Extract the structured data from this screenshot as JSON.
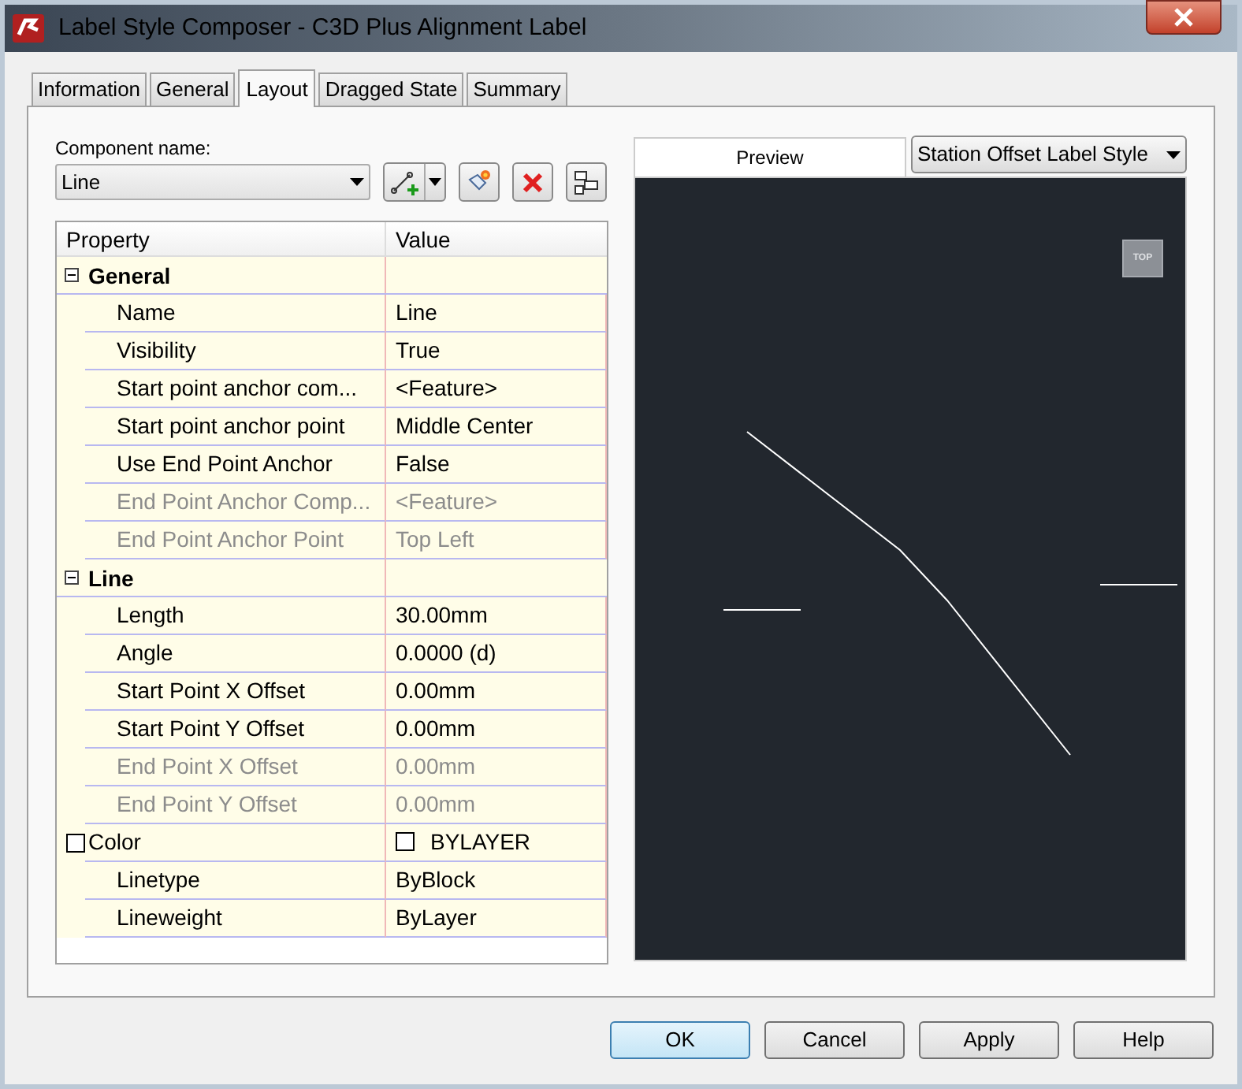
{
  "window": {
    "title": "Label Style Composer - C3D Plus Alignment Label"
  },
  "tabs": [
    {
      "label": "Information",
      "selected": false
    },
    {
      "label": "General",
      "selected": false
    },
    {
      "label": "Layout",
      "selected": true
    },
    {
      "label": "Dragged State",
      "selected": false
    },
    {
      "label": "Summary",
      "selected": false
    }
  ],
  "component": {
    "label": "Component name:",
    "value": "Line"
  },
  "grid": {
    "columns": [
      "Property",
      "Value"
    ],
    "groups": [
      {
        "name": "General",
        "expanded": true,
        "children": [
          {
            "kind": "text",
            "name": "Name",
            "value": "Line",
            "disabled": false
          },
          {
            "kind": "text",
            "name": "Visibility",
            "value": "True",
            "disabled": false
          },
          {
            "kind": "text",
            "name": "Start point anchor com...",
            "value": "<Feature>",
            "disabled": false
          },
          {
            "kind": "text",
            "name": "Start point anchor point",
            "value": "Middle Center",
            "disabled": false
          },
          {
            "kind": "text",
            "name": "Use End Point Anchor",
            "value": "False",
            "disabled": false
          },
          {
            "kind": "text",
            "name": "End Point Anchor Comp...",
            "value": "<Feature>",
            "disabled": true
          },
          {
            "kind": "text",
            "name": "End Point Anchor Point",
            "value": "Top Left",
            "disabled": true
          }
        ]
      },
      {
        "name": "Line",
        "expanded": true,
        "children": [
          {
            "kind": "text",
            "name": "Length",
            "value": "30.00mm",
            "disabled": false
          },
          {
            "kind": "text",
            "name": "Angle",
            "value": "0.0000 (d)",
            "disabled": false
          },
          {
            "kind": "text",
            "name": "Start Point X Offset",
            "value": "0.00mm",
            "disabled": false
          },
          {
            "kind": "text",
            "name": "Start Point Y Offset",
            "value": "0.00mm",
            "disabled": false
          },
          {
            "kind": "text",
            "name": "End Point X Offset",
            "value": "0.00mm",
            "disabled": true
          },
          {
            "kind": "text",
            "name": "End Point Y Offset",
            "value": "0.00mm",
            "disabled": true
          },
          {
            "kind": "color",
            "name": "Color",
            "value": "BYLAYER",
            "checked": false,
            "disabled": false
          },
          {
            "kind": "text",
            "name": "Linetype",
            "value": "ByBlock",
            "disabled": false
          },
          {
            "kind": "text",
            "name": "Lineweight",
            "value": "ByLayer",
            "disabled": false
          }
        ]
      }
    ]
  },
  "preview": {
    "label": "Preview",
    "style": "Station Offset Label Style",
    "view_cube": "TOP"
  },
  "buttons": [
    {
      "label": "OK",
      "default": true
    },
    {
      "label": "Cancel",
      "default": false
    },
    {
      "label": "Apply",
      "default": false
    },
    {
      "label": "Help",
      "default": false
    }
  ]
}
